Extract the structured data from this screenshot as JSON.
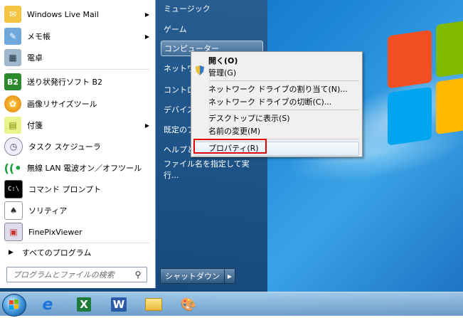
{
  "start_menu": {
    "programs": [
      {
        "label": "Windows Live Mail",
        "icon": "mail-icon",
        "submenu": true
      },
      {
        "label": "メモ帳",
        "icon": "notepad-icon",
        "submenu": true
      },
      {
        "label": "電卓",
        "icon": "calculator-icon",
        "submenu": false
      },
      {
        "label": "送り状発行ソフト B2",
        "icon": "b2-icon",
        "icon_text": "B2",
        "submenu": false
      },
      {
        "label": "画像リサイズツール",
        "icon": "resize-icon",
        "submenu": false
      },
      {
        "label": "付箋",
        "icon": "sticky-notes-icon",
        "submenu": true
      },
      {
        "label": "タスク スケジューラ",
        "icon": "clock-icon",
        "submenu": false
      },
      {
        "label": "無線 LAN 電波オン／オフツール",
        "icon": "wireless-icon",
        "submenu": false
      },
      {
        "label": "コマンド プロンプト",
        "icon": "cmd-icon",
        "submenu": false
      },
      {
        "label": "ソリティア",
        "icon": "solitaire-icon",
        "submenu": false
      },
      {
        "label": "FinePixViewer",
        "icon": "finepix-icon",
        "submenu": false
      }
    ],
    "all_programs": "すべてのプログラム",
    "search_placeholder": "プログラムとファイルの検索",
    "right_items": [
      "ミュージック",
      "ゲーム",
      "コンピューター",
      "ネットワ",
      "コントロ",
      "デバイス",
      "既定のプ",
      "ヘルプと",
      "ファイル名を指定して実行..."
    ],
    "shutdown_label": "シャットダウン"
  },
  "context_menu": {
    "items": [
      {
        "label": "開く(O)",
        "bold": true
      },
      {
        "label": "管理(G)",
        "bold": false,
        "icon": "shield-icon"
      },
      {
        "label": "ネットワーク ドライブの割り当て(N)...",
        "bold": false
      },
      {
        "label": "ネットワーク ドライブの切断(C)...",
        "bold": false
      },
      {
        "label": "デスクトップに表示(S)",
        "bold": false
      },
      {
        "label": "名前の変更(M)",
        "bold": false
      },
      {
        "label": "プロパティ(R)",
        "bold": false,
        "highlighted": true
      }
    ]
  },
  "taskbar": {
    "apps": [
      "internet-explorer-icon",
      "excel-icon",
      "word-icon",
      "explorer-icon",
      "paint-icon"
    ],
    "excel_glyph": "X",
    "word_glyph": "W"
  },
  "colors": {
    "highlight_box": "#e00000",
    "desktop_blue": "#1c86d6"
  }
}
